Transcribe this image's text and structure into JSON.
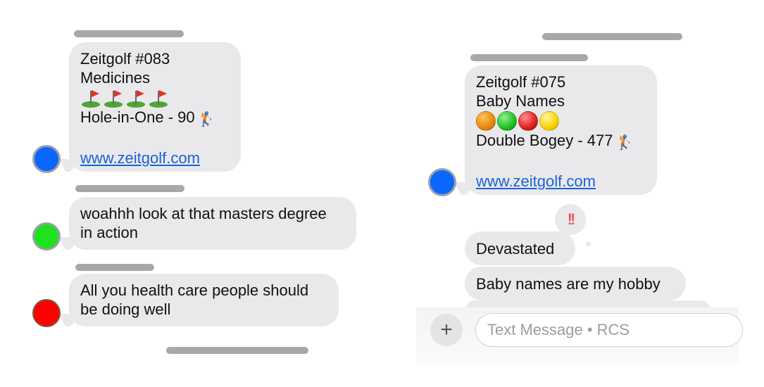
{
  "left_thread": {
    "msg1": {
      "line1": "Zeitgolf #083",
      "line2": "Medicines",
      "line3": "Hole-in-One - 90",
      "link": "www.zeitgolf.com"
    },
    "msg2": {
      "line1": "woahhh look at that masters degree",
      "line2": "in action"
    },
    "msg3": {
      "line1": "All you health care people should",
      "line2": "be doing well"
    }
  },
  "right_thread": {
    "msg1": {
      "line1": "Zeitgolf #075",
      "line2": "Baby Names",
      "line3": "Double Bogey - 477",
      "link": "www.zeitgolf.com"
    },
    "reaction": "!!",
    "msg2": "Devastated",
    "msg3": "Baby names are my hobby"
  },
  "composer": {
    "plus": "+",
    "placeholder": "Text Message • RCS"
  },
  "colors": {
    "bubble_bg": "#e9e9eb",
    "link": "#1a63d7",
    "avatar_blue": "#0a66ff",
    "avatar_green": "#1ee21e",
    "avatar_red": "#ff0000",
    "ball_colors": [
      "#e8890c",
      "#1fc11f",
      "#e01f1f",
      "#f6d400"
    ],
    "reaction": "#f05a5a"
  },
  "icons": {
    "flag": "golf-flag-icon",
    "golfer": "golfer-icon",
    "plus": "plus-icon"
  }
}
